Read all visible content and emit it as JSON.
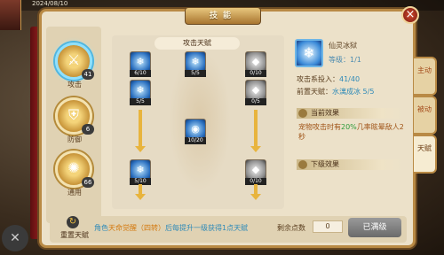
{
  "status_bar": {
    "time": "2024/08/10"
  },
  "panel": {
    "title": "技能"
  },
  "categories": [
    {
      "label": "攻击",
      "count": "41",
      "icon": "sword-icon",
      "glyph": "🗡"
    },
    {
      "label": "防御",
      "count": "6",
      "icon": "shield-icon",
      "glyph": "🛡"
    },
    {
      "label": "通用",
      "count": "66",
      "icon": "swirl-icon",
      "glyph": "🌀"
    }
  ],
  "tree": {
    "title": "攻击天赋",
    "nodes": [
      {
        "count": "6/10",
        "icon": "ice-skill-icon"
      },
      {
        "count": "5/5",
        "icon": "ice-skill-icon"
      },
      {
        "count": "0/10",
        "icon": "stone-skill-icon"
      },
      {
        "count": "5/5",
        "icon": "ice-skill-icon"
      },
      {
        "count": "0/5",
        "icon": "stone-skill-icon"
      },
      {
        "count": "10/20",
        "icon": "water-orb-icon"
      },
      {
        "count": "5/10",
        "icon": "ice-skill-icon"
      },
      {
        "count": "0/10",
        "icon": "stone-skill-icon"
      }
    ]
  },
  "detail": {
    "skill_name": "仙灵冰狱",
    "level_label": "等级：",
    "level_value": "1/1",
    "invest_label": "攻击系投入：",
    "invest_value": "41/40",
    "prereq_label": "前置天赋：",
    "prereq_value": "水漓成冰 5/5",
    "current_effect_header": "当前效果",
    "effect_part1": "宠物攻击时有",
    "effect_percent": "20%",
    "effect_part2": "几率眩晕敌人2秒",
    "next_effect_header": "下级效果"
  },
  "side_tabs": [
    {
      "label": "主动"
    },
    {
      "label": "被动"
    },
    {
      "label": "天赋"
    }
  ],
  "bottom": {
    "reset_label": "重置天赋",
    "notice_part1": "角色",
    "notice_highlight": "天命觉醒（四转）",
    "notice_part2": "后每提升一级获得1点天赋",
    "remain_label": "剩余点数",
    "remain_value": "0",
    "maxed_label": "已满级"
  },
  "colors": {
    "accent_blue": "#2e8ab8",
    "accent_green": "#2e9a3a",
    "accent_orange": "#d47a10",
    "panel_bg": "#ece1c9"
  }
}
